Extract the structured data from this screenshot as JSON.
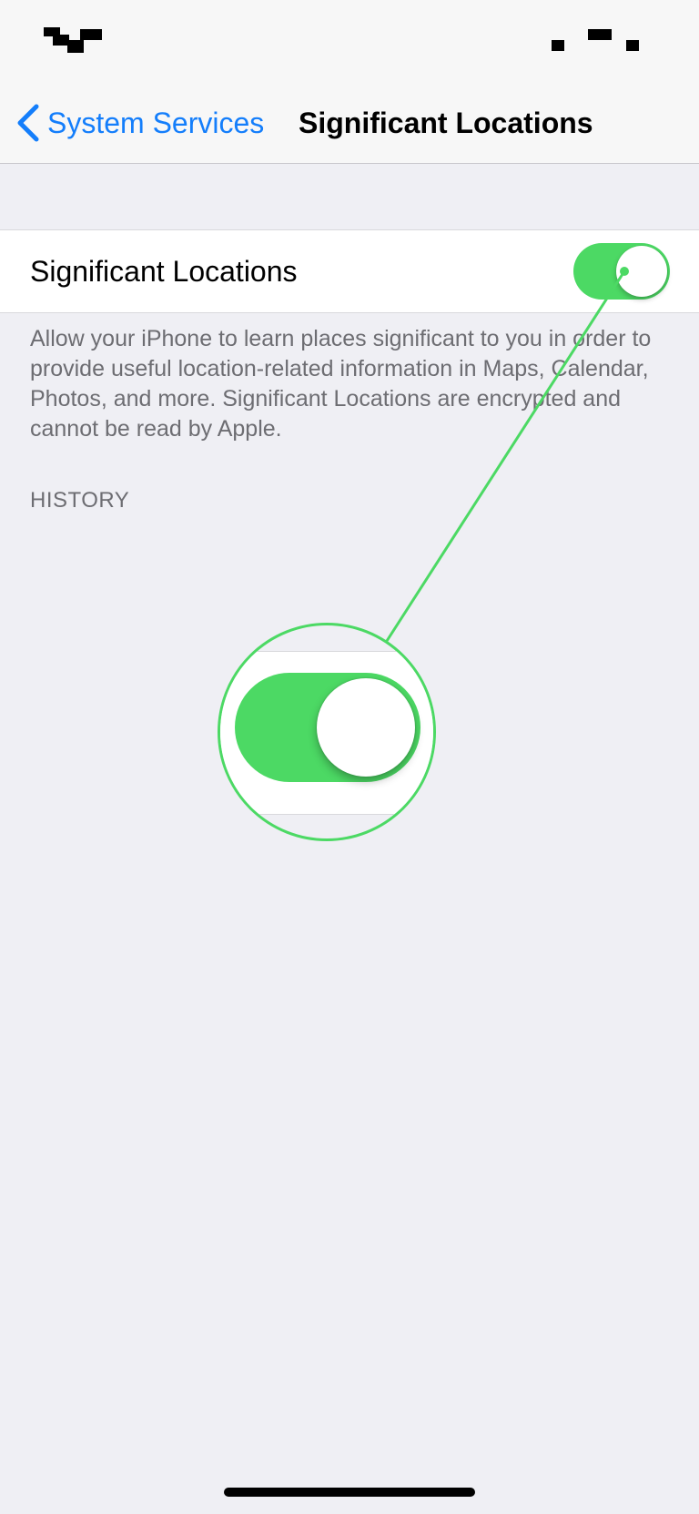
{
  "status_bar": {
    "left_icon": "redacted-time-glyph",
    "right_icon": "redacted-status-glyph"
  },
  "nav": {
    "back_label": "System Services",
    "back_icon": "chevron-left-icon",
    "title": "Significant Locations"
  },
  "setting": {
    "label": "Significant Locations",
    "toggle_on": true
  },
  "description": "Allow your iPhone to learn places significant to you in order to provide useful location-related information in Maps, Calendar, Photos, and more. Significant Locations are encrypted and cannot be read by Apple.",
  "section_header": "HISTORY",
  "colors": {
    "accent": "#147efb",
    "toggle_on": "#4cd964",
    "background": "#efeff4",
    "secondary_text": "#6d6d72"
  }
}
